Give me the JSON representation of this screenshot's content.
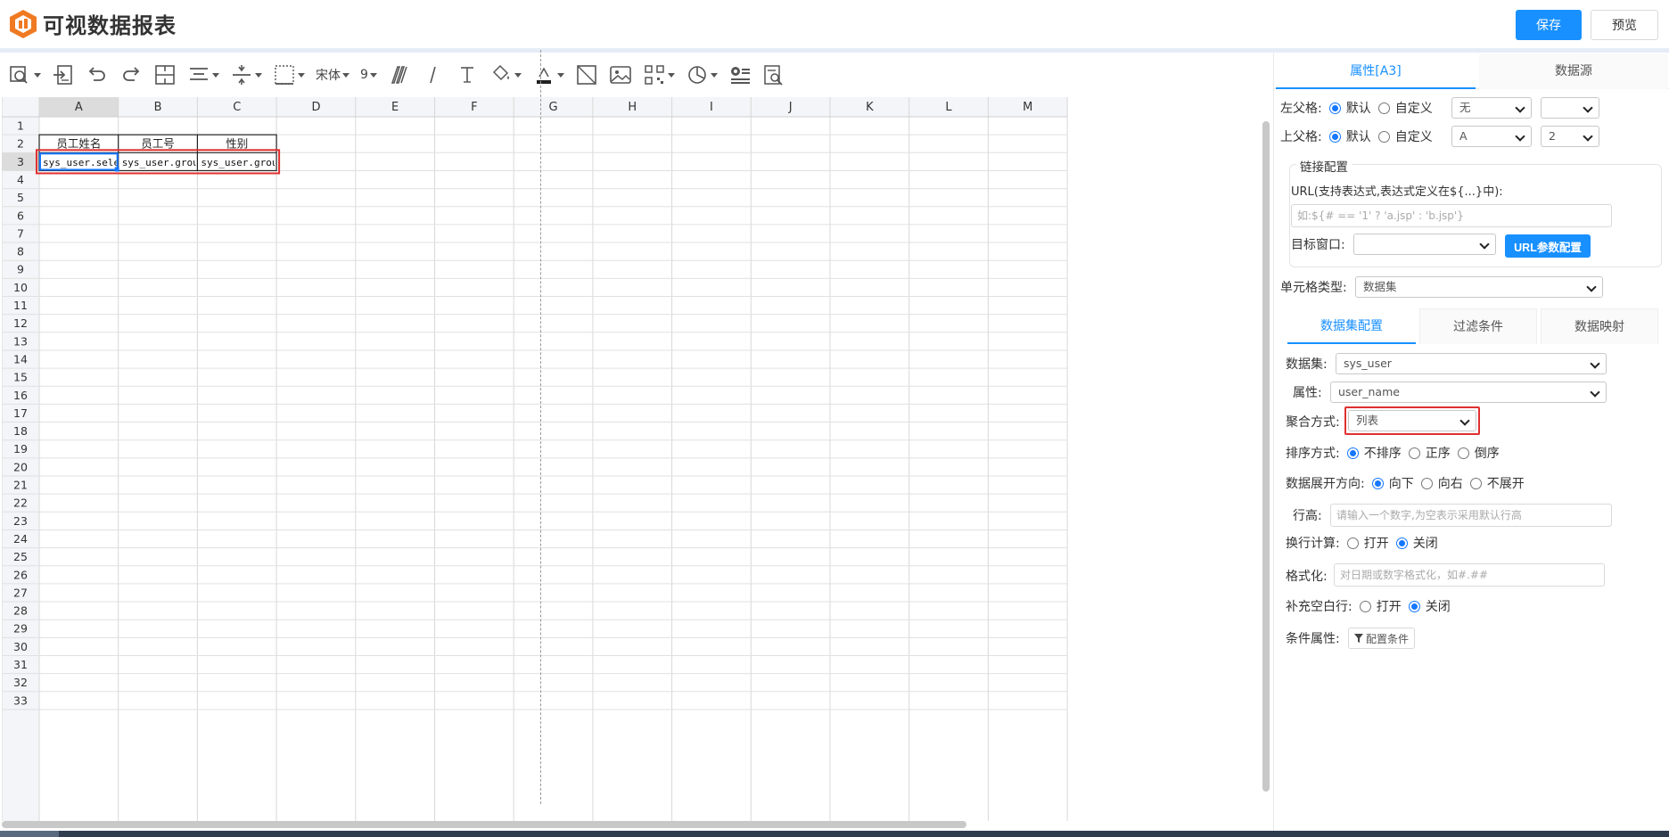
{
  "app": {
    "title": "可视数据报表",
    "save_label": "保存",
    "preview_label": "预览",
    "accent": "#1890ff"
  },
  "toolbar": {
    "font_name": "宋体",
    "font_size": "9"
  },
  "sheet": {
    "columns": [
      "A",
      "B",
      "C",
      "D",
      "E",
      "F",
      "G",
      "H",
      "I",
      "J",
      "K",
      "L",
      "M"
    ],
    "rows": 33,
    "selected_cell": "A3",
    "headers_row2": [
      "员工姓名",
      "员工号",
      "性别"
    ],
    "cells_row3": [
      "sys_user.select(u",
      "sys_user.group(us",
      "sys_user.group(us"
    ]
  },
  "panel": {
    "tabs": [
      "属性[A3]",
      "数据源"
    ],
    "left_parent": {
      "label": "左父格:",
      "opt_default": "默认",
      "opt_custom": "自定义",
      "select1": "无",
      "select2": ""
    },
    "top_parent": {
      "label": "上父格:",
      "opt_default": "默认",
      "opt_custom": "自定义",
      "select1": "A",
      "select2": "2"
    },
    "link": {
      "legend": "链接配置",
      "url_label": "URL(支持表达式,表达式定义在${...}中):",
      "url_placeholder": "如:${# == '1' ? 'a.jsp' : 'b.jsp'}",
      "target_label": "目标窗口:",
      "target_value": "",
      "param_btn": "URL参数配置"
    },
    "cell_type": {
      "label": "单元格类型:",
      "value": "数据集"
    },
    "subtabs": [
      "数据集配置",
      "过滤条件",
      "数据映射"
    ],
    "dataset": {
      "label": "数据集:",
      "value": "sys_user"
    },
    "attribute": {
      "label": "属性:",
      "value": "user_name"
    },
    "aggregate": {
      "label": "聚合方式:",
      "value": "列表"
    },
    "sort": {
      "label": "排序方式:",
      "opts": [
        "不排序",
        "正序",
        "倒序"
      ]
    },
    "expand": {
      "label": "数据展开方向:",
      "opts": [
        "向下",
        "向右",
        "不展开"
      ]
    },
    "row_height": {
      "label": "行高:",
      "placeholder": "请输入一个数字,为空表示采用默认行高"
    },
    "wrap": {
      "label": "换行计算:",
      "opts": [
        "打开",
        "关闭"
      ]
    },
    "format": {
      "label": "格式化:",
      "placeholder": "对日期或数字格式化，如#.##"
    },
    "fill_blank": {
      "label": "补充空白行:",
      "opts": [
        "打开",
        "关闭"
      ]
    },
    "condition": {
      "label": "条件属性:",
      "btn": "配置条件"
    }
  }
}
